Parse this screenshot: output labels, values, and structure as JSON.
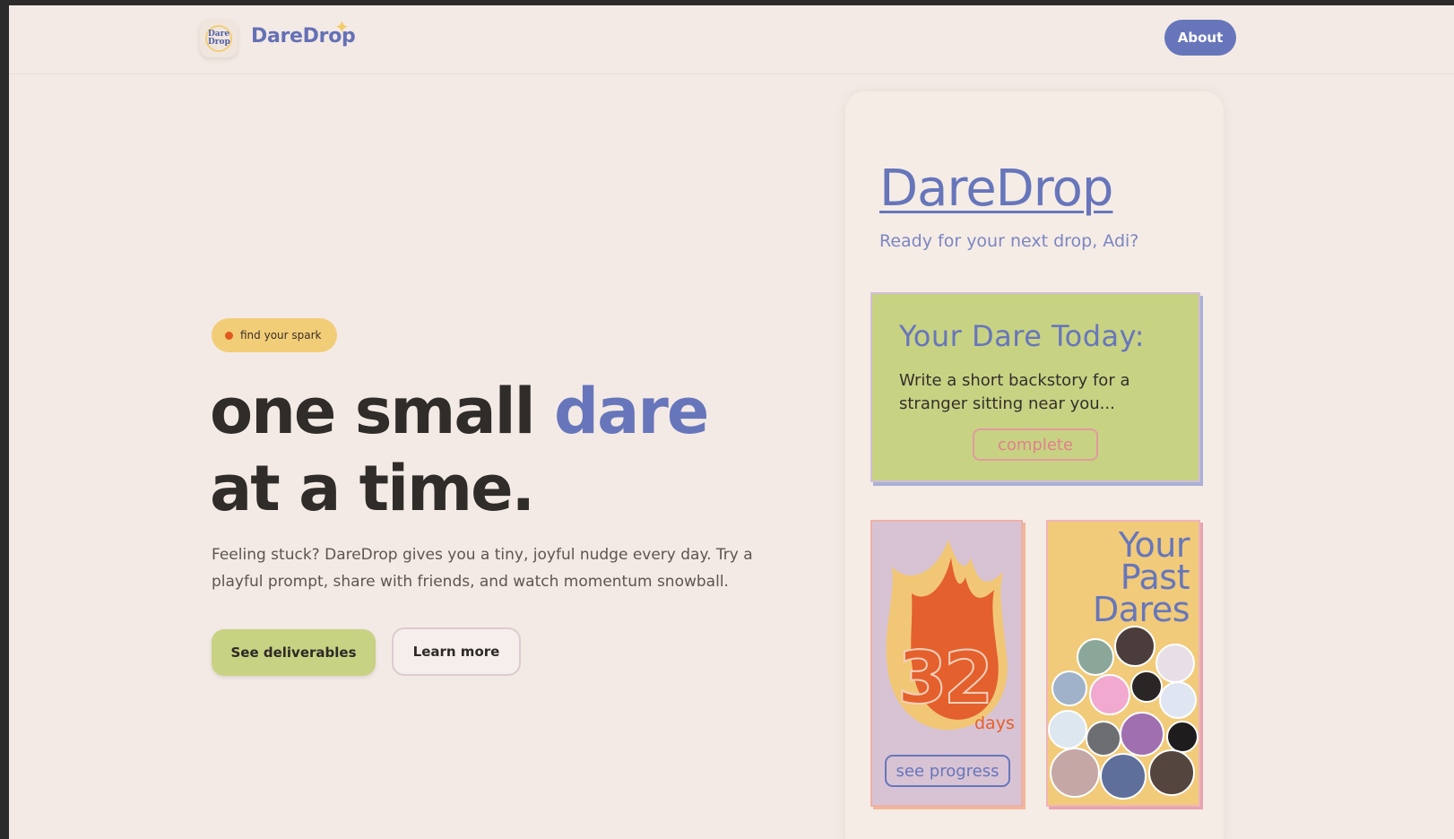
{
  "header": {
    "logo_text": "Dare Drop",
    "brand": "DareDrop",
    "about_label": "About"
  },
  "hero": {
    "pill": "find your spark",
    "headline_part1": "one small ",
    "headline_accent": "dare",
    "headline_part2": "at a time.",
    "subtext": "Feeling stuck? DareDrop gives you a tiny, joyful nudge every day. Try a playful prompt, share with friends, and watch momentum snowball.",
    "primary_button": "See deliverables",
    "secondary_button": "Learn more"
  },
  "phone": {
    "app_title": "DareDrop",
    "greeting": "Ready for your next drop, Adi?",
    "dare_card": {
      "heading": "Your Dare Today:",
      "body": "Write a short backstory for a stranger sitting near you...",
      "button": "complete"
    },
    "streak_card": {
      "count": "32",
      "unit": "days",
      "button": "see progress"
    },
    "past_card": {
      "title": "Your Past Dares"
    }
  },
  "colors": {
    "background": "#f4eae5",
    "accent_blue": "#6776bb",
    "lime": "#c8d283",
    "yellow": "#f2cd78",
    "orange": "#e4602c",
    "dark_text": "#2f2c2a"
  }
}
